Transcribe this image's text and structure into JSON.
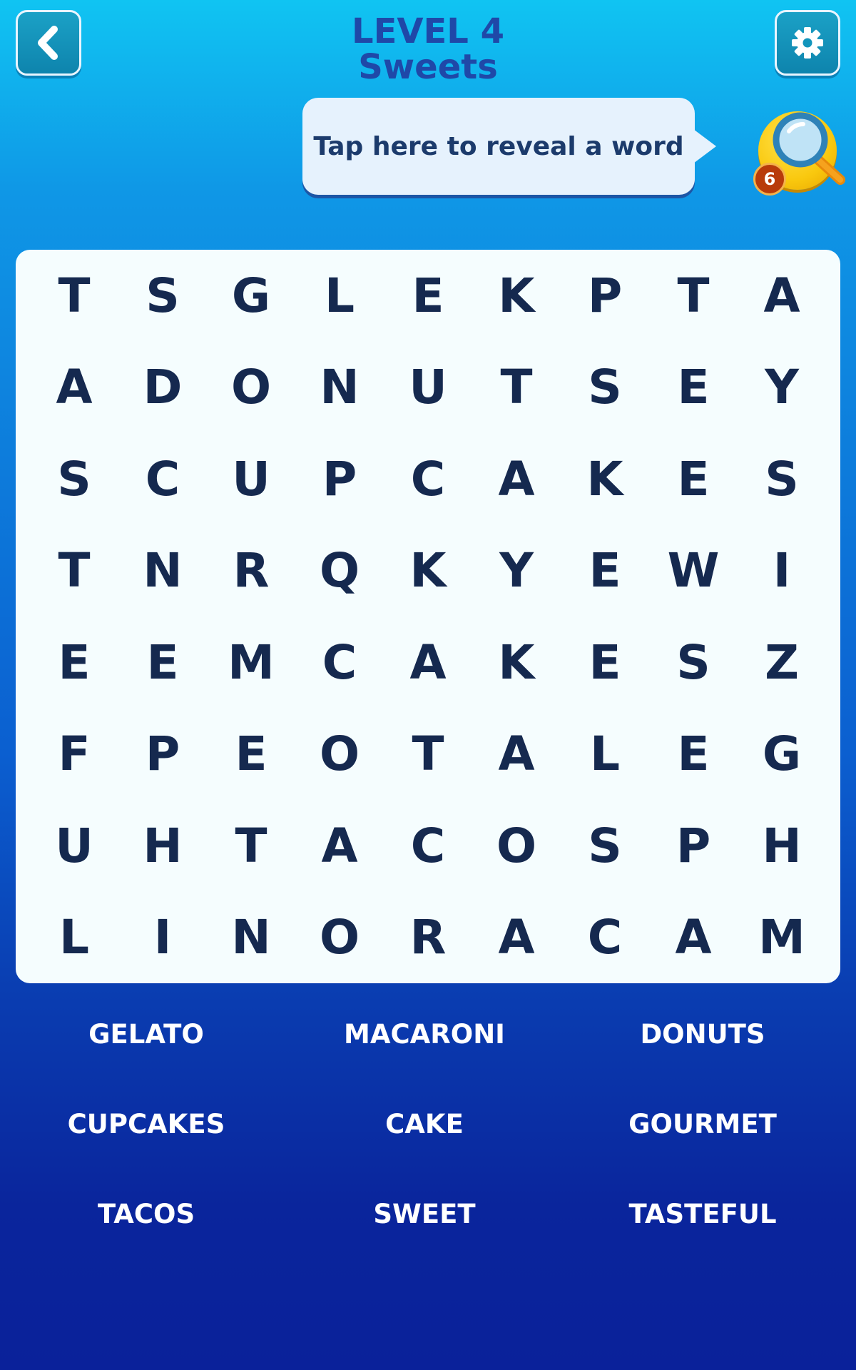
{
  "header": {
    "level_title": "LEVEL 4",
    "category": "Sweets",
    "back_icon": "chevron-left-icon",
    "settings_icon": "gear-icon"
  },
  "hint": {
    "text": "Tap here to reveal a word",
    "reveal_icon": "magnifier-icon",
    "reveal_count": "6"
  },
  "colors": {
    "background_top": "#10c4f2",
    "background_bottom": "#0a219a",
    "letters": "#15294f",
    "board": "#f5fdfe",
    "title": "#1f48a8"
  },
  "grid": {
    "rows": [
      [
        "T",
        "S",
        "G",
        "L",
        "E",
        "K",
        "P",
        "T",
        "A"
      ],
      [
        "A",
        "D",
        "O",
        "N",
        "U",
        "T",
        "S",
        "E",
        "Y"
      ],
      [
        "S",
        "C",
        "U",
        "P",
        "C",
        "A",
        "K",
        "E",
        "S"
      ],
      [
        "T",
        "N",
        "R",
        "Q",
        "K",
        "Y",
        "E",
        "W",
        "I"
      ],
      [
        "E",
        "E",
        "M",
        "C",
        "A",
        "K",
        "E",
        "S",
        "Z"
      ],
      [
        "F",
        "P",
        "E",
        "O",
        "T",
        "A",
        "L",
        "E",
        "G"
      ],
      [
        "U",
        "H",
        "T",
        "A",
        "C",
        "O",
        "S",
        "P",
        "H"
      ],
      [
        "L",
        "I",
        "N",
        "O",
        "R",
        "A",
        "C",
        "A",
        "M"
      ]
    ]
  },
  "words": [
    "GELATO",
    "MACARONI",
    "DONUTS",
    "CUPCAKES",
    "CAKE",
    "GOURMET",
    "TACOS",
    "SWEET",
    "TASTEFUL"
  ]
}
